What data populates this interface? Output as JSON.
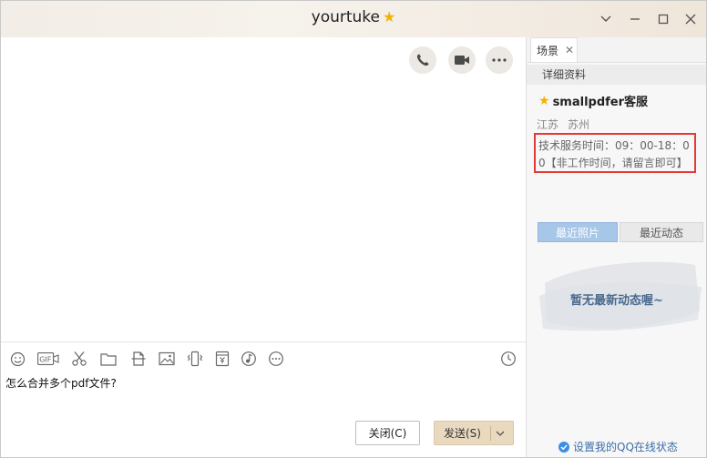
{
  "window": {
    "title": "yourtuke"
  },
  "chat": {
    "message": "怎么合并多个pdf文件?",
    "close_label": "关闭(C)",
    "send_label": "发送(S)"
  },
  "panel": {
    "tab_label": "场景",
    "section_title": "详细资料",
    "contact_name": "smallpdfer客服",
    "province": "江苏",
    "city": "苏州",
    "service_hours": "技术服务时间：09：00-18：00【非工作时间，请留言即可】",
    "photo_tabs": [
      "最近照片",
      "最近动态"
    ],
    "empty_news": "暂无最新动态喔~",
    "status_link": "设置我的QQ在线状态"
  },
  "colors": {
    "accent": "#f0b400",
    "highlight_border": "#e53935",
    "send_button": "#e9d9bf"
  }
}
